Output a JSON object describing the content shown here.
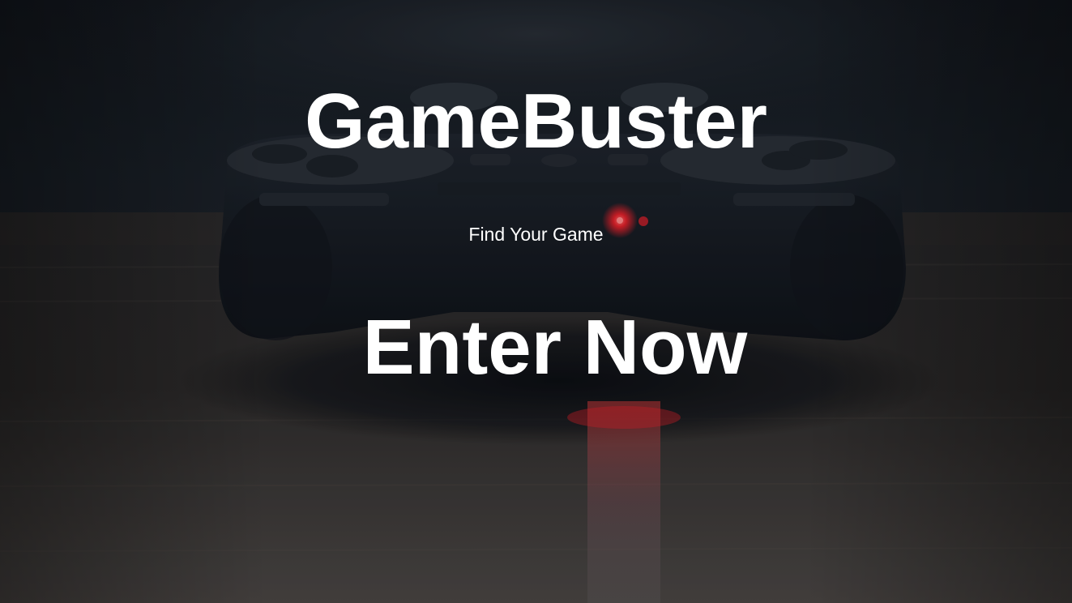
{
  "hero": {
    "title": "GameBuster",
    "tagline": "Find Your Game",
    "cta_label": "Enter Now"
  },
  "colors": {
    "text": "#ffffff",
    "background_dark": "#0e1116",
    "led_red": "#e0202a"
  },
  "background_image": {
    "subject": "game-controller-photo"
  }
}
